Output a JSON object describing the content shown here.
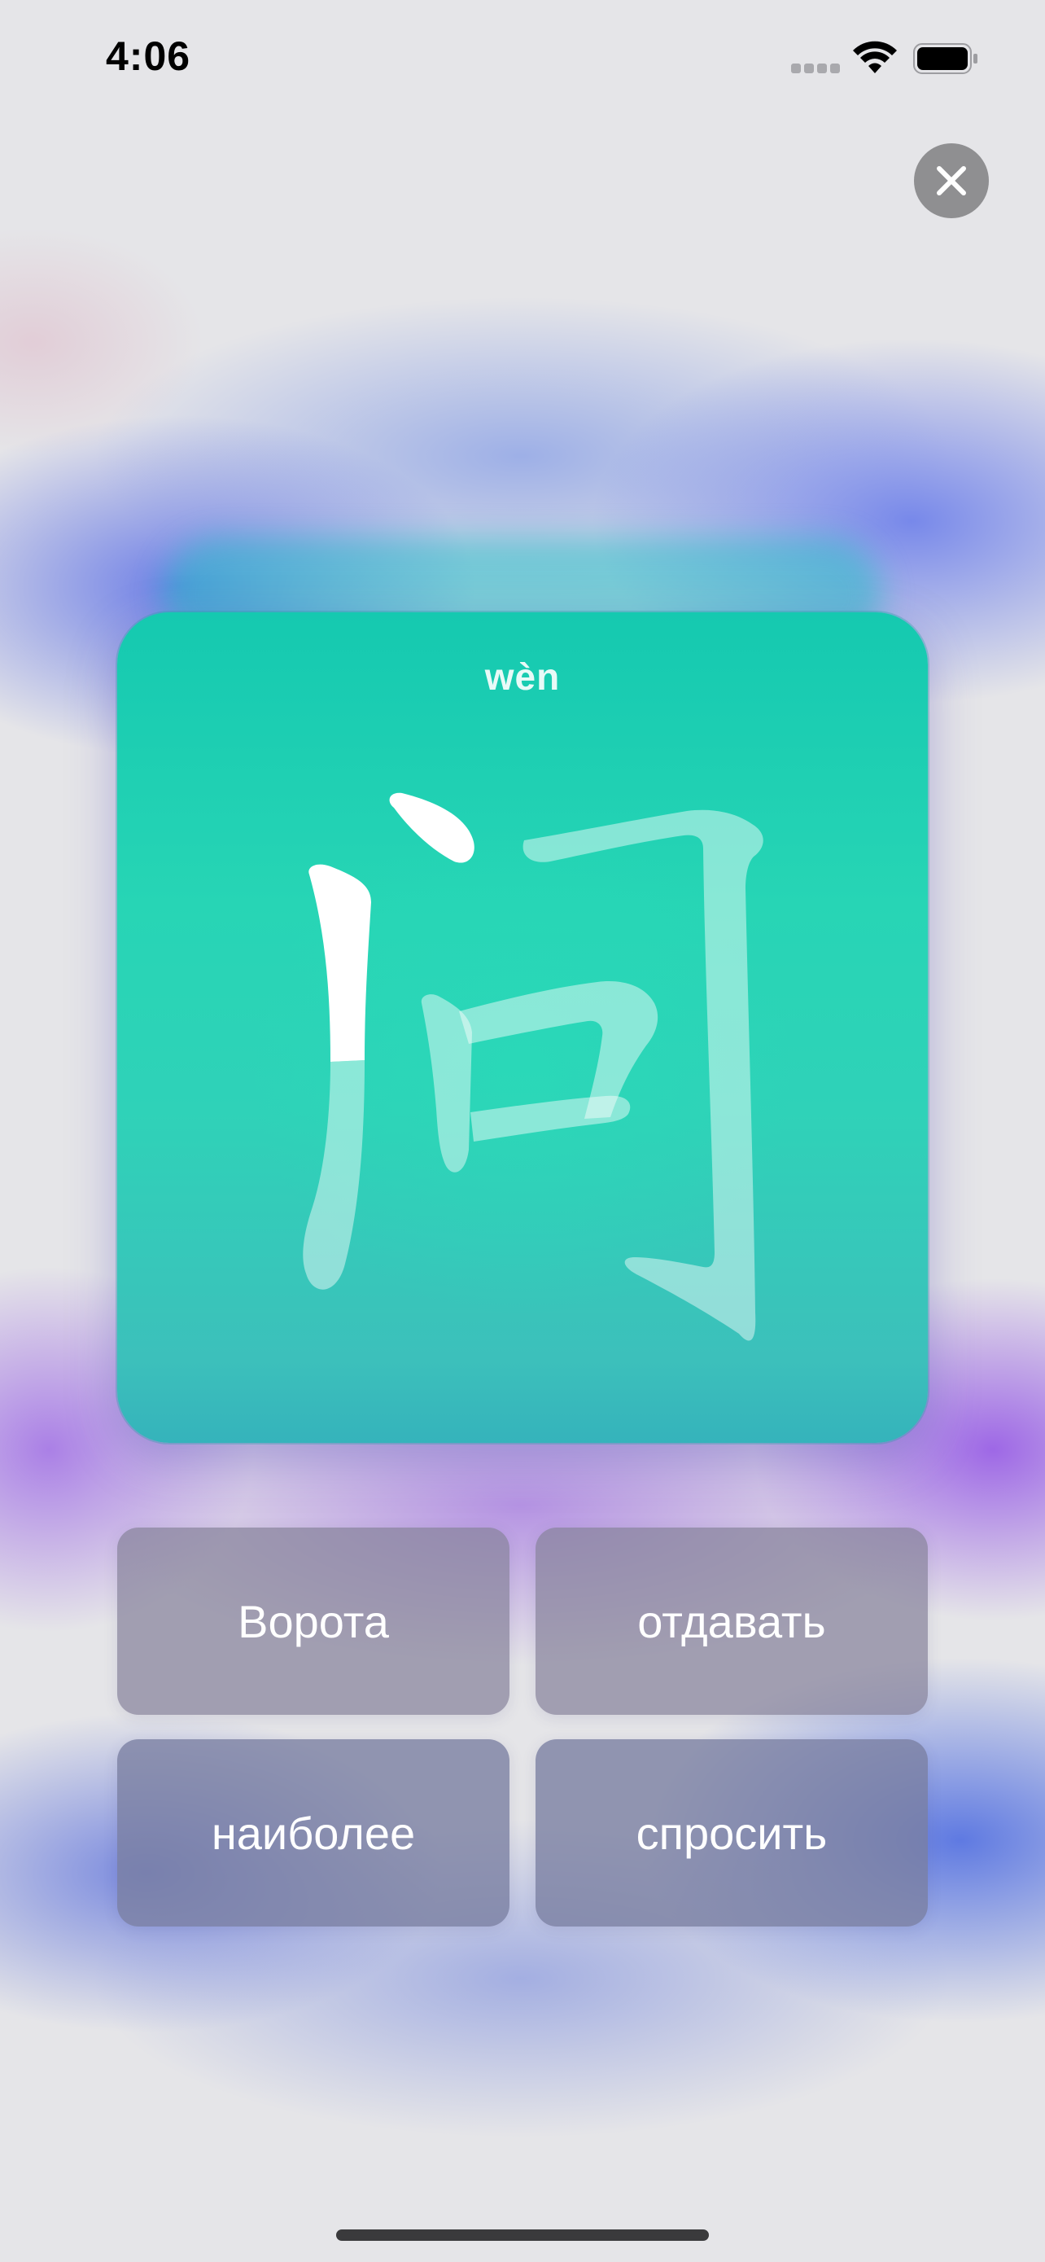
{
  "status_bar": {
    "time": "4:06",
    "icons": [
      "cellular-signal-icon",
      "wifi-icon",
      "battery-icon"
    ]
  },
  "close_button": {
    "icon": "close-icon"
  },
  "flashcard": {
    "pinyin": "wèn",
    "character": "问",
    "card_color": "#27d5b5",
    "stroke_progress": "first stroke partially completed (white), remaining strokes translucent"
  },
  "answers": [
    {
      "label": "Ворота"
    },
    {
      "label": "отдавать"
    },
    {
      "label": "наиболее"
    },
    {
      "label": "спросить"
    }
  ],
  "colors": {
    "accent": "#27d5b5",
    "button_bg": "#8a86a0",
    "close_button_bg": "#8f8f91"
  }
}
